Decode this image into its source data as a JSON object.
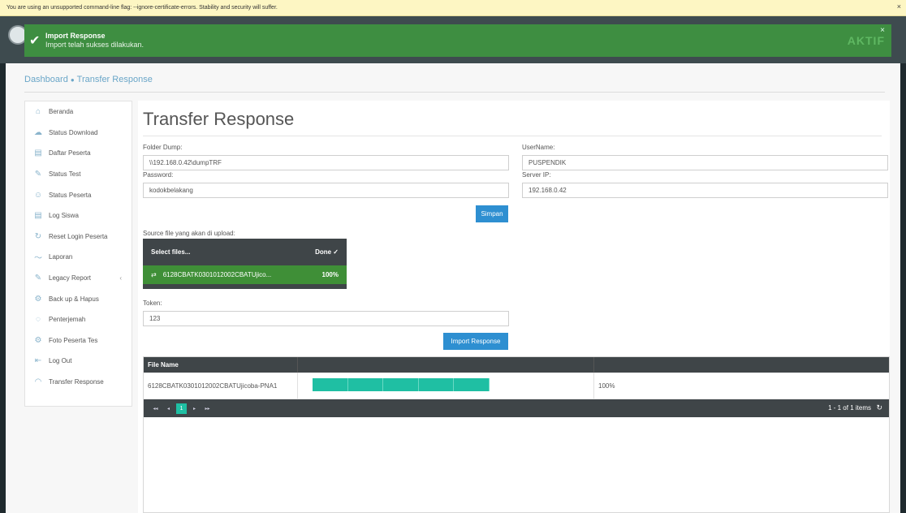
{
  "infobar": {
    "message": "You are using an unsupported command-line flag: --ignore-certificate-errors. Stability and security will suffer.",
    "close": "×"
  },
  "toast": {
    "title": "Import Response",
    "message": "Import telah sukses dilakukan.",
    "close": "×",
    "status": "AKTIF",
    "color": "#3e8e41"
  },
  "breadcrumb": {
    "home": "Dashboard",
    "current": "Transfer Response"
  },
  "sidebar": {
    "items": [
      {
        "label": "Beranda",
        "icon": "home-icon",
        "glyph": "⌂"
      },
      {
        "label": "Status Download",
        "icon": "cloud-download-icon",
        "glyph": "☁"
      },
      {
        "label": "Daftar Peserta",
        "icon": "list-icon",
        "glyph": "▤"
      },
      {
        "label": "Status Test",
        "icon": "edit-icon",
        "glyph": "✎"
      },
      {
        "label": "Status Peserta",
        "icon": "user-icon",
        "glyph": "☺"
      },
      {
        "label": "Log Siswa",
        "icon": "log-icon",
        "glyph": "▤"
      },
      {
        "label": "Reset Login Peserta",
        "icon": "reset-icon",
        "glyph": "↻"
      },
      {
        "label": "Laporan",
        "icon": "chart-icon",
        "glyph": "〜"
      },
      {
        "label": "Legacy Report",
        "icon": "report-icon",
        "glyph": "✎"
      },
      {
        "label": "Back up & Hapus",
        "icon": "backup-icon",
        "glyph": "⚙"
      },
      {
        "label": "Penterjemah",
        "icon": "translate-icon",
        "glyph": "◌"
      },
      {
        "label": "Foto Peserta Tes",
        "icon": "camera-icon",
        "glyph": "⚙"
      },
      {
        "label": "Log Out",
        "icon": "logout-icon",
        "glyph": "⇤"
      },
      {
        "label": "Transfer Response",
        "icon": "rss-icon",
        "glyph": "◠"
      }
    ],
    "legacy_chevron": "‹"
  },
  "main": {
    "title": "Transfer Response",
    "folder_label": "Folder Dump:",
    "folder_value": "\\\\192.168.0.42\\dumpTRF",
    "password_label": "Password:",
    "password_value": "kodokbelakang",
    "username_label": "UserName:",
    "username_value": "PUSPENDIK",
    "server_label": "Server IP:",
    "server_value": "192.168.0.42",
    "save_button": "Simpan",
    "source_label": "Source file yang akan di upload:",
    "upload": {
      "select_label": "Select files...",
      "done_label": "Done ✓",
      "file_name": "6128CBATK0301012002CBATUjico...",
      "percent": "100%"
    },
    "token_label": "Token:",
    "token_value": "123",
    "import_button": "Import Response"
  },
  "grid": {
    "columns": [
      "File Name",
      "",
      ""
    ],
    "rows": [
      {
        "file_name": "6128CBATK0301012002CBATUjicoba-PNA1",
        "progress": 1.0,
        "percent": "100%"
      }
    ],
    "pager": {
      "first": "◂◂",
      "prev": "◂",
      "page": "1",
      "next": "▸",
      "last": "▸▸",
      "info": "1 - 1 of 1 items",
      "refresh": "↻"
    }
  }
}
